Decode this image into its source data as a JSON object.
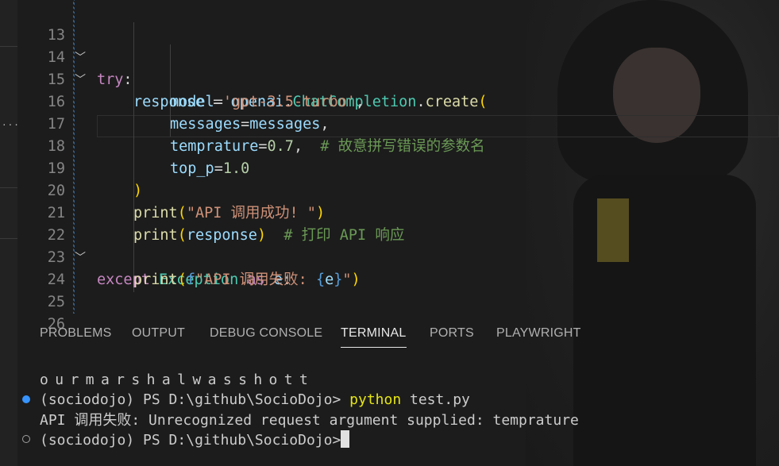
{
  "editor": {
    "lines": [
      {
        "num": "13",
        "fold": "﹀"
      },
      {
        "num": "14",
        "fold": "﹀"
      },
      {
        "num": "15",
        "fold": ""
      },
      {
        "num": "16",
        "fold": ""
      },
      {
        "num": "17",
        "fold": ""
      },
      {
        "num": "18",
        "fold": ""
      },
      {
        "num": "19",
        "fold": ""
      },
      {
        "num": "20",
        "fold": ""
      },
      {
        "num": "21",
        "fold": ""
      },
      {
        "num": "22",
        "fold": "﹀"
      },
      {
        "num": "23",
        "fold": ""
      },
      {
        "num": "24",
        "fold": ""
      },
      {
        "num": "25",
        "fold": ""
      },
      {
        "num": "26",
        "fold": ""
      }
    ],
    "code": {
      "l13": {
        "kw": "try",
        "colon": ":"
      },
      "l14": {
        "var": "response",
        "eq": " = ",
        "mod": "openai",
        "dot1": ".",
        "cls": "ChatCompletion",
        "dot2": ".",
        "fn": "create",
        "open": "("
      },
      "l15": {
        "param": "model",
        "eq": "=",
        "str": "'gpt-3.5-turbo'",
        "comma": ","
      },
      "l16": {
        "param": "messages",
        "eq": "=",
        "var": "messages",
        "comma": ","
      },
      "l17": {
        "param": "temprature",
        "eq": "=",
        "num": "0.7",
        "comma": ",  ",
        "comment": "# 故意拼写错误的参数名"
      },
      "l18": {
        "param": "top_p",
        "eq": "=",
        "num": "1.0"
      },
      "l19": {
        "close": ")"
      },
      "l20": {
        "fn": "print",
        "open": "(",
        "str": "\"API 调用成功! \"",
        "close": ")"
      },
      "l21": {
        "fn": "print",
        "open": "(",
        "var": "response",
        "close": ")",
        "comment": "  # 打印 API 响应"
      },
      "l22": {
        "kw": "except",
        "cls": "Exception",
        "as": "as",
        "var": "e",
        "colon": ":"
      },
      "l23": {
        "fn": "print",
        "open": "(",
        "fprefix": "f",
        "str": "\"API 调用失败: ",
        "brace_open": "{",
        "var": "e",
        "brace_close": "}",
        "str_end": "\"",
        "close": ")"
      }
    }
  },
  "panel": {
    "tabs": [
      "PROBLEMS",
      "OUTPUT",
      "DEBUG CONSOLE",
      "TERMINAL",
      "PORTS",
      "PLAYWRIGHT"
    ],
    "active_tab": "TERMINAL"
  },
  "terminal": {
    "line1": "ourmarshalwasshott",
    "prompt": "(sociodojo) PS D:\\github\\SocioDojo>",
    "cmd_name": "python",
    "cmd_args": " test.py",
    "error": "API 调用失败: Unrecognized request argument supplied: temprature",
    "prompt2": "(sociodojo) PS D:\\github\\SocioDojo>"
  },
  "sidebar": {
    "dots": "..."
  },
  "colors": {
    "keyword": "#c586c0",
    "variable": "#9cdcfe",
    "function": "#dcdcaa",
    "class": "#4ec9b0",
    "string": "#ce9178",
    "number": "#b5cea8",
    "comment": "#6a9955",
    "command": "#e5e510"
  }
}
